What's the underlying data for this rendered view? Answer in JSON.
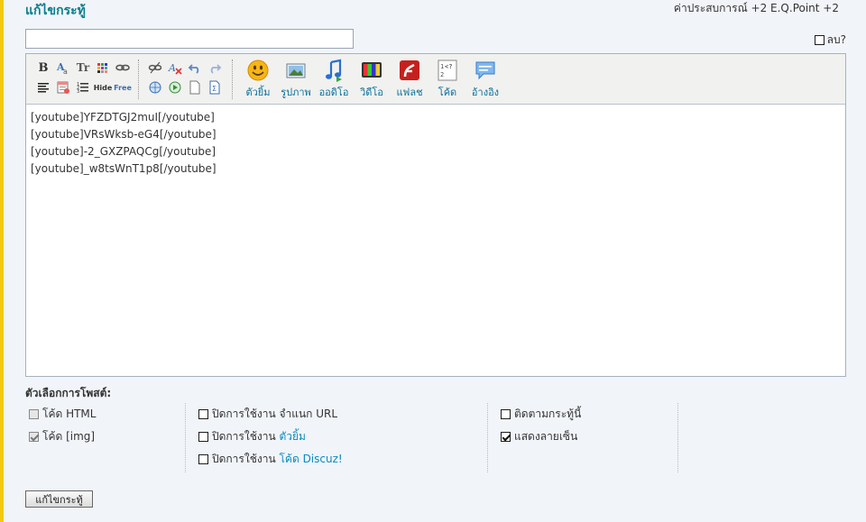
{
  "header": {
    "title": "แก้ไขกระทู้",
    "points": "ค่าประสบการณ์ +2  E.Q.Point +2"
  },
  "subject": {
    "value": ""
  },
  "delete_label": "ลบ?",
  "toolbar": {
    "big_tools": [
      {
        "label": "ตัวยิ้ม",
        "icon": "smiley-icon"
      },
      {
        "label": "รูปภาพ",
        "icon": "image-icon"
      },
      {
        "label": "ออดิโอ",
        "icon": "audio-icon"
      },
      {
        "label": "วิดีโอ",
        "icon": "video-icon"
      },
      {
        "label": "แฟลช",
        "icon": "flash-icon"
      },
      {
        "label": "โค้ด",
        "icon": "code-icon"
      },
      {
        "label": "อ้างอิง",
        "icon": "quote-icon"
      }
    ],
    "small_text": {
      "bold": "B",
      "fontsize": "Tr",
      "hide": "Hide",
      "free": "Free"
    }
  },
  "editor": {
    "lines": [
      "[youtube]YFZDTGJ2muI[/youtube]",
      "[youtube]VRsWksb-eG4[/youtube]",
      "[youtube]-2_GXZPAQCg[/youtube]",
      "[youtube]_w8tsWnT1p8[/youtube]"
    ]
  },
  "options": {
    "title": "ตัวเลือกการโพสต์:",
    "html_code": "โค้ด HTML",
    "img_code": "โค้ด [img]",
    "disable_url_prefix": "ปิดการใช้งาน จำแนก URL",
    "disable_smiley_prefix": "ปิดการใช้งาน ",
    "disable_smiley_link": "ตัวยิ้ม",
    "disable_discuz_prefix": "ปิดการใช้งาน ",
    "disable_discuz_link": "โค้ด Discuz!",
    "follow_thread": "ติดตามกระทู้นี้",
    "show_signature": "แสดงลายเซ็น"
  },
  "submit_label": "แก้ไขกระทู้",
  "colors": {
    "accent": "#0a7e8c",
    "left_bar": "#f3c814",
    "link": "#0a8abf"
  }
}
